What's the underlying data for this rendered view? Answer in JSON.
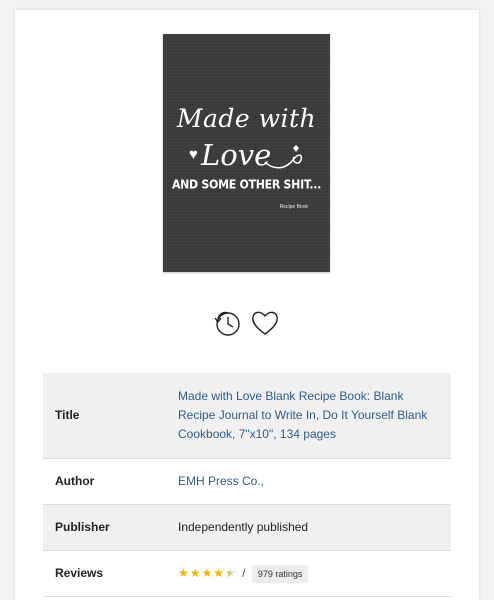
{
  "cover": {
    "line1": "Made with",
    "line2": "Love",
    "line3": "AND SOME OTHER SHIT...",
    "small": "Recipe Book"
  },
  "actions": [
    {
      "icon": "clock-history-icon"
    },
    {
      "icon": "heart-outline-icon"
    }
  ],
  "details": {
    "title_label": "Title",
    "title_value": "Made with Love Blank Recipe Book: Blank Recipe Journal to Write In, Do It Yourself Blank Cookbook, 7\"x10\", 134 pages",
    "author_label": "Author",
    "author_value": "EMH Press Co.,",
    "publisher_label": "Publisher",
    "publisher_value": "Independently published",
    "reviews_label": "Reviews",
    "rating": 4.5,
    "rating_separator": "/",
    "ratings_count": "979 ratings"
  },
  "colors": {
    "link": "#2f5d8a",
    "star": "#f5b400",
    "cover_bg": "#3b3c3b"
  }
}
